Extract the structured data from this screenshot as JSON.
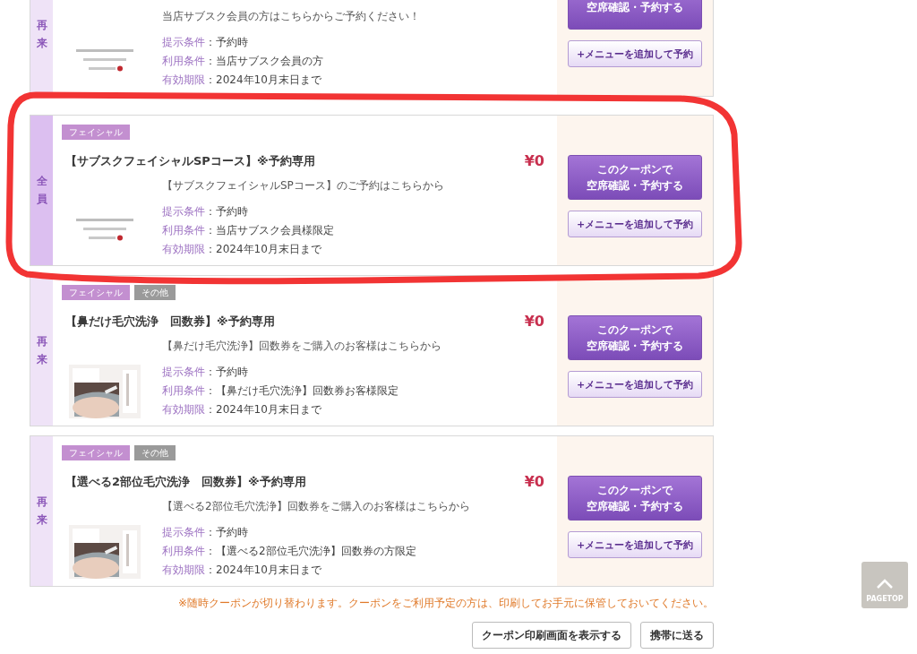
{
  "coupons": [
    {
      "target": {
        "label": "再来",
        "color": "#efe3f7"
      },
      "description": "当店サブスク会員の方はこちらからご予約ください！",
      "image": {
        "kind": "picture"
      },
      "conditions": [
        {
          "label": "提示条件",
          "value": "：予約時"
        },
        {
          "label": "利用条件",
          "value": "：当店サブスク会員の方"
        },
        {
          "label": "有効期限",
          "value": "：2024年10月末日まで"
        }
      ],
      "reserve_lines": [
        "空席確認・予約する"
      ],
      "add_button": "+メニューを追加して予約"
    },
    {
      "target": {
        "label": "全員",
        "color": "#dcbff0"
      },
      "tags": [
        {
          "label": "フェイシャル",
          "color": "#c38fd0"
        }
      ],
      "title": "【サブスクフェイシャルSPコース】※予約専用",
      "price": "¥0",
      "description": "【サブスクフェイシャルSPコース】のご予約はこちらから",
      "image": {
        "kind": "picture"
      },
      "conditions": [
        {
          "label": "提示条件",
          "value": "：予約時"
        },
        {
          "label": "利用条件",
          "value": "：当店サブスク会員様限定"
        },
        {
          "label": "有効期限",
          "value": "：2024年10月末日まで"
        }
      ],
      "reserve_lines": [
        "このクーポンで",
        "空席確認・予約する"
      ],
      "add_button": "+メニューを追加して予約"
    },
    {
      "target": {
        "label": "再来",
        "color": "#efe3f7"
      },
      "tags": [
        {
          "label": "フェイシャル",
          "color": "#c38fd0"
        },
        {
          "label": "その他",
          "color": "#9a9a9a"
        }
      ],
      "title": "【鼻だけ毛穴洗浄　回数券】※予約専用",
      "price": "¥0",
      "description": "【鼻だけ毛穴洗浄】回数券をご購入のお客様はこちらから",
      "image": {
        "kind": "picture"
      },
      "conditions": [
        {
          "label": "提示条件",
          "value": "：予約時"
        },
        {
          "label": "利用条件",
          "value": "：【鼻だけ毛穴洗浄】回数券お客様限定"
        },
        {
          "label": "有効期限",
          "value": "：2024年10月末日まで"
        }
      ],
      "reserve_lines": [
        "このクーポンで",
        "空席確認・予約する"
      ],
      "add_button": "+メニューを追加して予約"
    },
    {
      "target": {
        "label": "再来",
        "color": "#efe3f7"
      },
      "tags": [
        {
          "label": "フェイシャル",
          "color": "#c38fd0"
        },
        {
          "label": "その他",
          "color": "#9a9a9a"
        }
      ],
      "title": "【選べる2部位毛穴洗浄　回数券】※予約専用",
      "price": "¥0",
      "description": "【選べる2部位毛穴洗浄】回数券をご購入のお客様はこちらから",
      "image": {
        "kind": "picture"
      },
      "conditions": [
        {
          "label": "提示条件",
          "value": "：予約時"
        },
        {
          "label": "利用条件",
          "value": "：【選べる2部位毛穴洗浄】回数券の方限定"
        },
        {
          "label": "有効期限",
          "value": "：2024年10月末日まで"
        }
      ],
      "reserve_lines": [
        "このクーポンで",
        "空席確認・予約する"
      ],
      "add_button": "+メニューを追加して予約"
    }
  ],
  "notice": "※随時クーポンが切り替わります。クーポンをご利用予定の方は、印刷してお手元に保管しておいてください。",
  "actions": [
    "クーポン印刷画面を表示する",
    "携帯に送る"
  ],
  "page_top": "PAGETOP",
  "annotation": {
    "kind": "ring"
  }
}
